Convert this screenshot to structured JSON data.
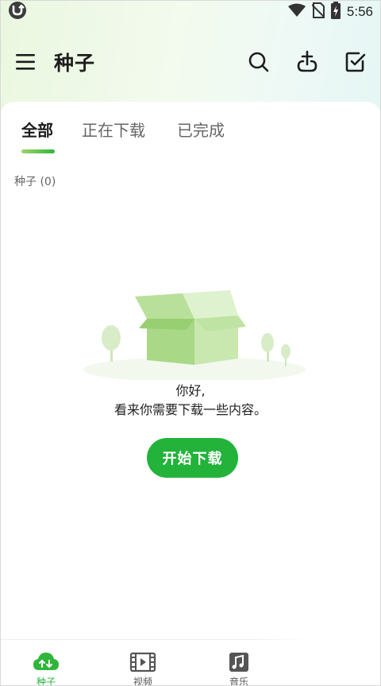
{
  "status_bar": {
    "time": "5:56",
    "icons": [
      "utorrent-notification-icon",
      "wifi-icon",
      "no-sim-icon",
      "battery-charging-icon"
    ]
  },
  "app_bar": {
    "title": "种子",
    "actions": [
      "search-icon",
      "add-link-icon",
      "select-all-checkbox-icon"
    ]
  },
  "tabs": [
    {
      "label": "全部",
      "active": true
    },
    {
      "label": "正在下载",
      "active": false
    },
    {
      "label": "已完成",
      "active": false
    }
  ],
  "list": {
    "count_label": "种子 (0)"
  },
  "empty_state": {
    "line1": "你好,",
    "line2": "看来你需要下载一些内容。",
    "button_label": "开始下载"
  },
  "bottom_nav": [
    {
      "label": "种子",
      "icon": "torrent-cloud-icon",
      "active": true
    },
    {
      "label": "视频",
      "icon": "video-film-icon",
      "active": false
    },
    {
      "label": "音乐",
      "icon": "music-icon",
      "active": false
    }
  ],
  "colors": {
    "accent": "#23b33a",
    "header_gradient": "#eaf7df",
    "illustration_green": "#bfe3a2"
  }
}
